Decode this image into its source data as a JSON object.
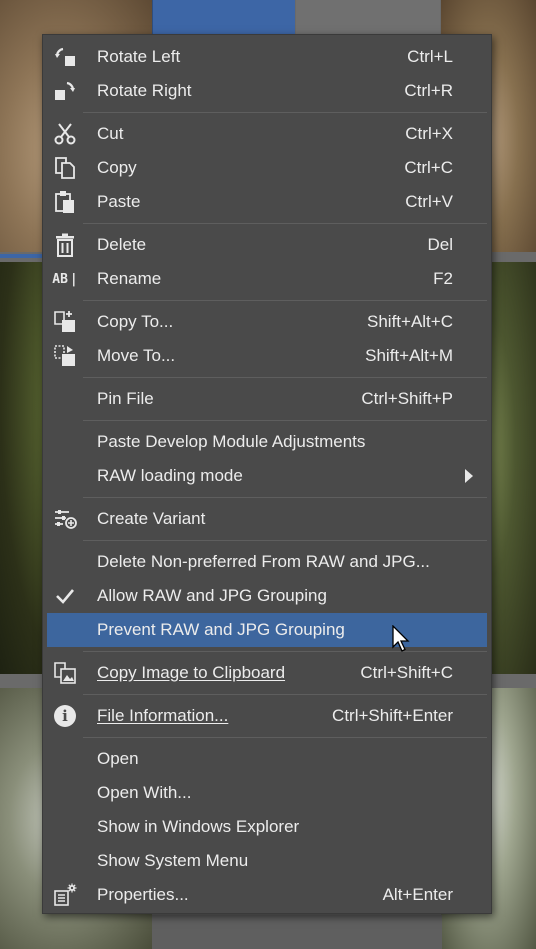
{
  "menu": {
    "items": [
      {
        "label": "Rotate Left",
        "shortcut": "Ctrl+L",
        "icon": "rotate-left-icon"
      },
      {
        "label": "Rotate Right",
        "shortcut": "Ctrl+R",
        "icon": "rotate-right-icon"
      },
      {
        "label": "Cut",
        "shortcut": "Ctrl+X",
        "icon": "scissors-icon"
      },
      {
        "label": "Copy",
        "shortcut": "Ctrl+C",
        "icon": "copy-icon"
      },
      {
        "label": "Paste",
        "shortcut": "Ctrl+V",
        "icon": "paste-icon"
      },
      {
        "label": "Delete",
        "shortcut": "Del",
        "icon": "trash-icon"
      },
      {
        "label": "Rename",
        "shortcut": "F2",
        "icon": "rename-icon",
        "icon_text": "AB"
      },
      {
        "label": "Copy To...",
        "shortcut": "Shift+Alt+C",
        "icon": "copy-to-icon"
      },
      {
        "label": "Move To...",
        "shortcut": "Shift+Alt+M",
        "icon": "move-to-icon"
      },
      {
        "label": "Pin File",
        "shortcut": "Ctrl+Shift+P"
      },
      {
        "label": "Paste Develop Module Adjustments",
        "shortcut": ""
      },
      {
        "label": "RAW loading mode",
        "shortcut": "",
        "submenu": true
      },
      {
        "label": "Create Variant",
        "shortcut": "",
        "icon": "sliders-plus-icon"
      },
      {
        "label": "Delete Non-preferred From RAW and JPG...",
        "shortcut": ""
      },
      {
        "label": "Allow RAW and JPG Grouping",
        "shortcut": "",
        "icon": "checkmark-icon",
        "checked": true
      },
      {
        "label": "Prevent RAW and JPG Grouping",
        "shortcut": "",
        "highlighted": true
      },
      {
        "label": "Copy Image to Clipboard",
        "shortcut": "Ctrl+Shift+C",
        "icon": "clipboard-image-icon"
      },
      {
        "label": "File Information...",
        "shortcut": "Ctrl+Shift+Enter",
        "icon": "info-icon",
        "icon_text": "i"
      },
      {
        "label": "Open",
        "shortcut": ""
      },
      {
        "label": "Open With...",
        "shortcut": ""
      },
      {
        "label": "Show in Windows Explorer",
        "shortcut": ""
      },
      {
        "label": "Show System Menu",
        "shortcut": ""
      },
      {
        "label": "Properties...",
        "shortcut": "Alt+Enter",
        "icon": "properties-icon"
      }
    ]
  },
  "colors": {
    "menu_bg": "#4a4a4a",
    "highlight": "#3d669e",
    "text": "#ececec"
  }
}
